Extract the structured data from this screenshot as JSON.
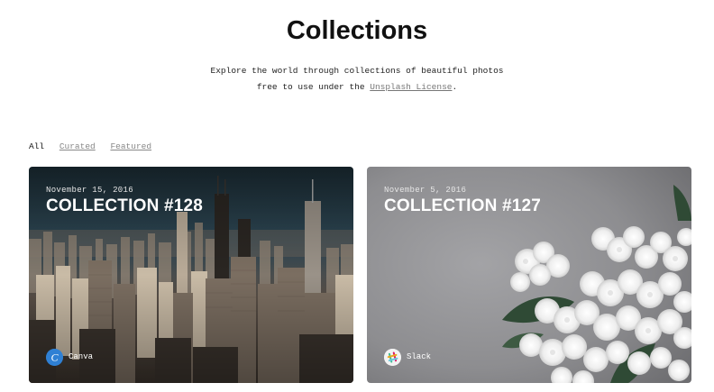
{
  "page": {
    "title": "Collections",
    "subtitle_line1": "Explore the world through collections of beautiful photos",
    "subtitle_line2_prefix": "free to use under the ",
    "subtitle_link": "Unsplash License",
    "subtitle_line2_suffix": "."
  },
  "filters": {
    "all": "All",
    "curated": "Curated",
    "featured": "Featured"
  },
  "collections": [
    {
      "date": "November 15, 2016",
      "title": "COLLECTION #128",
      "author": "Canva",
      "avatar_icon": "canva-logo-icon"
    },
    {
      "date": "November 5, 2016",
      "title": "COLLECTION #127",
      "author": "Slack",
      "avatar_icon": "slack-logo-icon"
    }
  ],
  "colors": {
    "canva_avatar": "#2f80d4",
    "card_text": "#ffffff"
  }
}
